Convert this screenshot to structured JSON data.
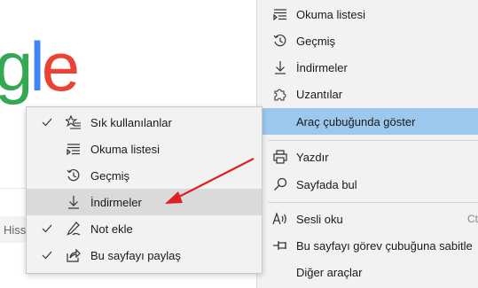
{
  "background": {
    "logo_letters": [
      "g",
      "l",
      "e"
    ],
    "search_hint": "Hiss"
  },
  "main_menu": {
    "items": [
      {
        "label": "Okuma listesi",
        "icon": "reading-list-icon"
      },
      {
        "label": "Geçmiş",
        "icon": "history-icon"
      },
      {
        "label": "İndirmeler",
        "icon": "download-icon"
      },
      {
        "label": "Uzantılar",
        "icon": "extensions-icon"
      },
      {
        "label": "Araç çubuğunda göster",
        "icon": "",
        "highlighted": true
      },
      {
        "label": "Yazdır",
        "icon": "print-icon"
      },
      {
        "label": "Sayfada bul",
        "icon": "find-icon"
      },
      {
        "label": "Sesli oku",
        "icon": "read-aloud-icon",
        "shortcut": "Ct"
      },
      {
        "label": "Bu sayfayı görev çubuğuna sabitle",
        "icon": "pin-taskbar-icon"
      },
      {
        "label": "Diğer araçlar",
        "icon": ""
      }
    ]
  },
  "sub_menu": {
    "items": [
      {
        "label": "Sık kullanılanlar",
        "checked": true,
        "icon": "favorites-icon"
      },
      {
        "label": "Okuma listesi",
        "checked": false,
        "icon": "reading-list-icon"
      },
      {
        "label": "Geçmiş",
        "checked": false,
        "icon": "history-icon"
      },
      {
        "label": "İndirmeler",
        "checked": false,
        "icon": "download-icon",
        "highlighted": true
      },
      {
        "label": "Not ekle",
        "checked": true,
        "icon": "pen-icon"
      },
      {
        "label": "Bu sayfayı paylaş",
        "checked": true,
        "icon": "share-icon"
      }
    ]
  },
  "annotation": {
    "arrow_color": "#e02020"
  },
  "colors": {
    "menu_bg": "#f2f2f2",
    "highlight_blue": "#9dc8ed",
    "highlight_gray": "#dadada"
  }
}
